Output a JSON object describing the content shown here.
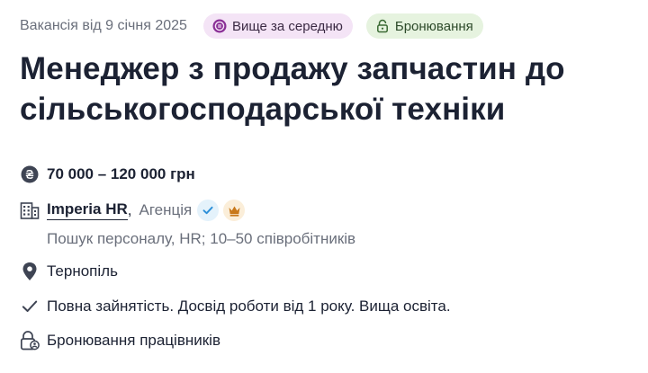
{
  "meta": {
    "posted": "Вакансія від 9 січня 2025",
    "badges": {
      "salary_level": {
        "label": "Вище за середню",
        "icon": "coin-icon",
        "bg": "#f4e4f6"
      },
      "booking": {
        "label": "Бронювання",
        "icon": "lock-icon",
        "bg": "#e6f3df"
      }
    }
  },
  "job": {
    "title": "Менеджер з продажу запчастин до сільськогосподарської техніки"
  },
  "details": {
    "salary": {
      "icon": "hryvnia-icon",
      "text": "70 000 – 120 000 грн"
    },
    "company": {
      "icon": "building-icon",
      "name": "Imperia HR",
      "separator": ",",
      "type": "Агенція",
      "verified_icon": "verified-check-icon",
      "premium_icon": "crown-icon",
      "description": "Пошук персоналу, HR; 10–50 співробітників"
    },
    "location": {
      "icon": "map-pin-icon",
      "text": "Тернопіль"
    },
    "employment": {
      "icon": "check-icon",
      "text": "Повна зайнятість. Досвід роботи від 1 року. Вища освіта."
    },
    "booking": {
      "icon": "lock-user-icon",
      "text": "Бронювання працівників"
    }
  },
  "colors": {
    "text": "#1c2233",
    "muted": "#6a6f7b",
    "verified": "#2b8fd8",
    "crown": "#c8781a"
  }
}
